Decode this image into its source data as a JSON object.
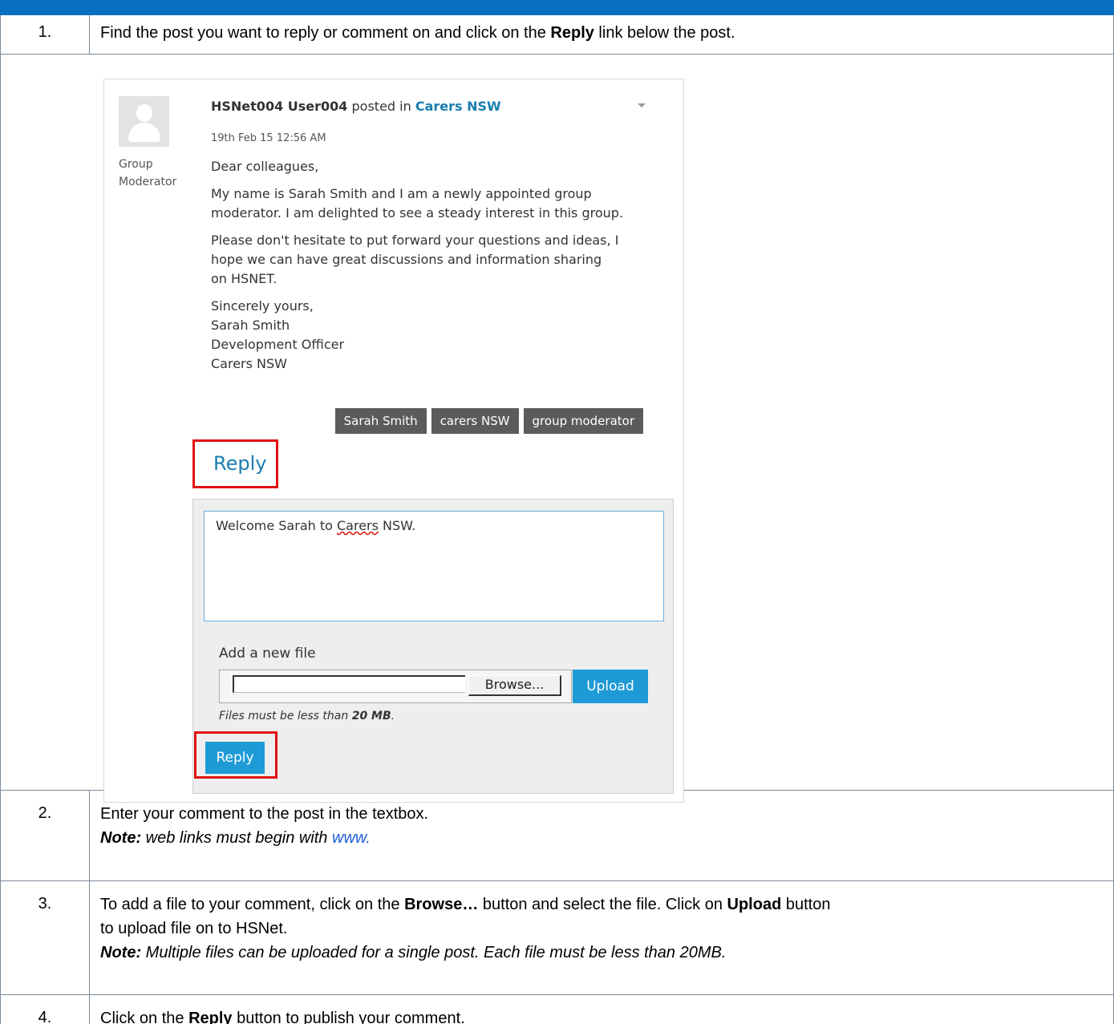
{
  "steps": [
    {
      "number": "1.",
      "text_before": "Find the post you want to reply or comment on and click on the ",
      "bold": "Reply",
      "text_after": " link below the post."
    },
    {
      "number": "2.",
      "line1": "Enter your comment to the post in the textbox.",
      "note_label": "Note:",
      "note_text": " web links must begin with ",
      "note_link": "www."
    },
    {
      "number": "3.",
      "part1": "To add a file to your comment, click on the ",
      "bold1": "Browse…",
      "part2": " button and select the file. Click on ",
      "bold2": "Upload",
      "part3": " button",
      "line2": "to upload file on to HSNet.",
      "note_label": "Note:",
      "note_text": " Multiple files can be uploaded for a single post. Each file must be less than 20MB."
    },
    {
      "number": "4.",
      "text_before": "Click on the ",
      "bold": "Reply",
      "text_after": " button to publish your comment."
    }
  ],
  "post": {
    "author": "HSNet004 User004",
    "posted_in": " posted in ",
    "group": "Carers NSW",
    "date": "19th Feb 15 12:56 AM",
    "role_line1": "Group",
    "role_line2": "Moderator",
    "greeting": "Dear colleagues,",
    "para1_line1": "My name is Sarah Smith and I am a newly appointed group",
    "para1_line2": "moderator. I am delighted to see a steady interest in this group.",
    "para2_line1": "Please don't hesitate to put forward your questions and ideas, I",
    "para2_line2": "hope we can have great discussions and information sharing",
    "para2_line3": "on HSNET.",
    "sign1": "Sincerely yours,",
    "sign2": "Sarah Smith",
    "sign3": "Development Officer",
    "sign4": "Carers NSW",
    "tags": [
      "Sarah Smith",
      "carers NSW",
      "group moderator"
    ],
    "reply_link": "Reply"
  },
  "reply_form": {
    "comment_before": "Welcome Sarah to ",
    "comment_spell": "Carers",
    "comment_after": " NSW.",
    "add_file_label": "Add a new file",
    "browse_label": "Browse...",
    "upload_label": "Upload",
    "file_note_text": "Files must be less than ",
    "file_note_bold": "20 MB",
    "file_note_end": ".",
    "reply_button": "Reply"
  },
  "colors": {
    "header_bar": "#0b6fbf",
    "accent": "#1e9ad6",
    "link": "#1a7db0",
    "highlight": "#e01010"
  }
}
